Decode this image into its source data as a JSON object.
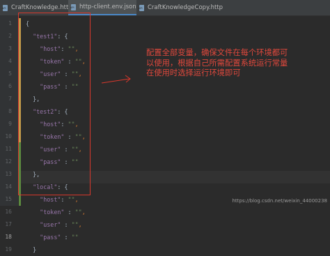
{
  "tabs": [
    {
      "label": "CraftKnowledge.http",
      "active": false,
      "closable": true
    },
    {
      "label": "http-client.env.json",
      "active": true,
      "closable": true
    },
    {
      "label": "CraftKnowledgeCopy.http",
      "active": false,
      "closable": false
    }
  ],
  "line_numbers": [
    "1",
    "2",
    "3",
    "4",
    "5",
    "6",
    "7",
    "8",
    "9",
    "10",
    "11",
    "12",
    "13",
    "14",
    "15",
    "16",
    "17",
    "18",
    "19"
  ],
  "current_line": "18",
  "json_lines": [
    [
      "{"
    ],
    [
      "  \"test1\"",
      ": {"
    ],
    [
      "    \"host\"",
      ": ",
      "\"\"",
      ","
    ],
    [
      "    \"token\"",
      " : ",
      "\"\"",
      ","
    ],
    [
      "    \"user\"",
      " : ",
      "\"\"",
      ","
    ],
    [
      "    \"pass\"",
      " : ",
      "\"\""
    ],
    [
      "  },"
    ],
    [
      "  \"test2\"",
      ": {"
    ],
    [
      "    \"host\"",
      ": ",
      "\"\"",
      ","
    ],
    [
      "    \"token\"",
      " : ",
      "\"\"",
      ","
    ],
    [
      "    \"user\"",
      " : ",
      "\"\"",
      ","
    ],
    [
      "    \"pass\"",
      " : ",
      "\"\""
    ],
    [
      "  },"
    ],
    [
      "  \"local\"",
      ": {"
    ],
    [
      "    \"host\"",
      ": ",
      "\"\"",
      ","
    ],
    [
      "    \"token\"",
      " : ",
      "\"\"",
      ","
    ],
    [
      "    \"user\"",
      " : ",
      "\"\"",
      ","
    ],
    [
      "    \"pass\"",
      " : ",
      "\"\""
    ],
    [
      "  }"
    ]
  ],
  "annotation": {
    "line1": "配置全部变量，确保文件在每个环境都可",
    "line2": "以使用，根据自己所需配置系统运行常量",
    "line3": "在使用时选择运行环境即可"
  },
  "watermark": "https://blog.csdn.net/weixin_44000238",
  "colors": {
    "accent_red": "#d9382c",
    "key": "#9876aa",
    "string": "#6a8759",
    "punctuation": "#cc7832"
  }
}
